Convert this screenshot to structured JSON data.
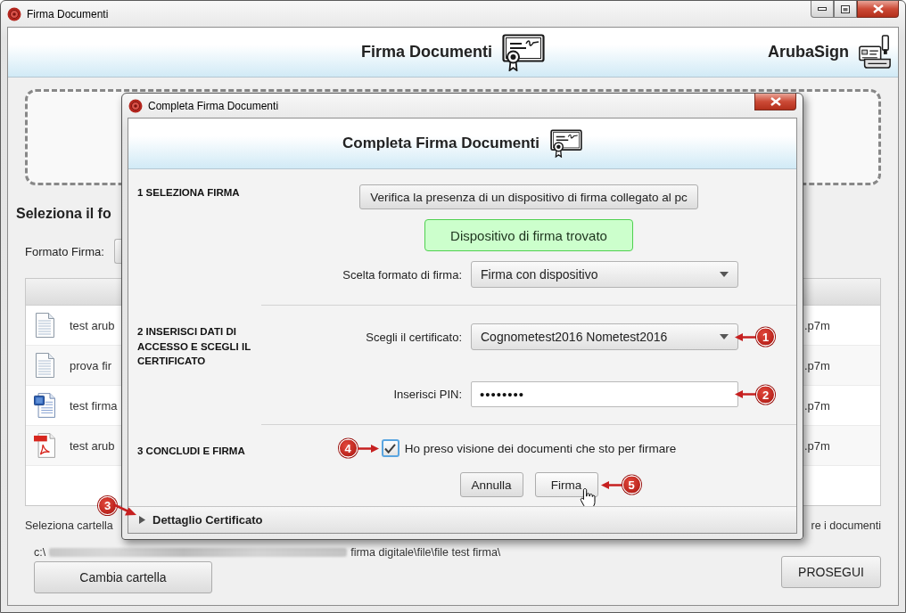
{
  "window": {
    "title": "Firma Documenti"
  },
  "header": {
    "title": "Firma Documenti",
    "brand": "ArubaSign"
  },
  "main": {
    "heading": "Seleziona il fo",
    "format_label": "Formato Firma:",
    "files": [
      {
        "kind": "text",
        "name": "test arub",
        "column_2": ".p7m"
      },
      {
        "kind": "text",
        "name": "prova fir",
        "column_2": ".p7m"
      },
      {
        "kind": "word",
        "name": "test firma",
        "column_2": ".p7m"
      },
      {
        "kind": "pdf",
        "name": "test arub",
        "column_2": ".p7m"
      }
    ],
    "folder_label": "Seleziona cartella",
    "folder_hint": "re i documenti",
    "path_start": "c:\\",
    "path_end": "firma digitale\\file\\file test firma\\",
    "change_folder_button": "Cambia cartella",
    "continue_button": "PROSEGUI"
  },
  "dialog": {
    "title": "Completa Firma Documenti",
    "header": "Completa Firma Documenti",
    "sections": [
      {
        "label": "1 SELEZIONA FIRMA",
        "items": [
          {
            "kind": "button",
            "label": "Verifica la presenza di un dispositivo di firma collegato al pc"
          },
          {
            "kind": "status",
            "text": "Dispositivo di firma trovato"
          },
          {
            "kind": "dropdown",
            "label": "Scelta formato di firma:",
            "value": "Firma con dispositivo"
          }
        ]
      },
      {
        "label": "2 INSERISCI DATI DI ACCESSO E SCEGLI IL CERTIFICATO",
        "items": [
          {
            "kind": "dropdown",
            "label": "Scegli il certificato:",
            "value": "Cognometest2016 Nometest2016",
            "callout": "1"
          },
          {
            "kind": "password",
            "label": "Inserisci PIN:",
            "value": "••••••••",
            "callout": "2"
          }
        ]
      },
      {
        "label": "3 CONCLUDI E FIRMA",
        "items": [
          {
            "kind": "checkbox",
            "label": "Ho preso visione dei documenti che sto per firmare",
            "checked": true,
            "callout": "4"
          },
          {
            "kind": "buttons",
            "buttons": [
              {
                "label": "Annulla",
                "hovered": false
              },
              {
                "label": "Firma",
                "hovered": true,
                "callout": "5"
              }
            ]
          }
        ]
      }
    ],
    "details": {
      "label": "Dettaglio Certificato",
      "expanded": false,
      "callout": "3"
    }
  }
}
